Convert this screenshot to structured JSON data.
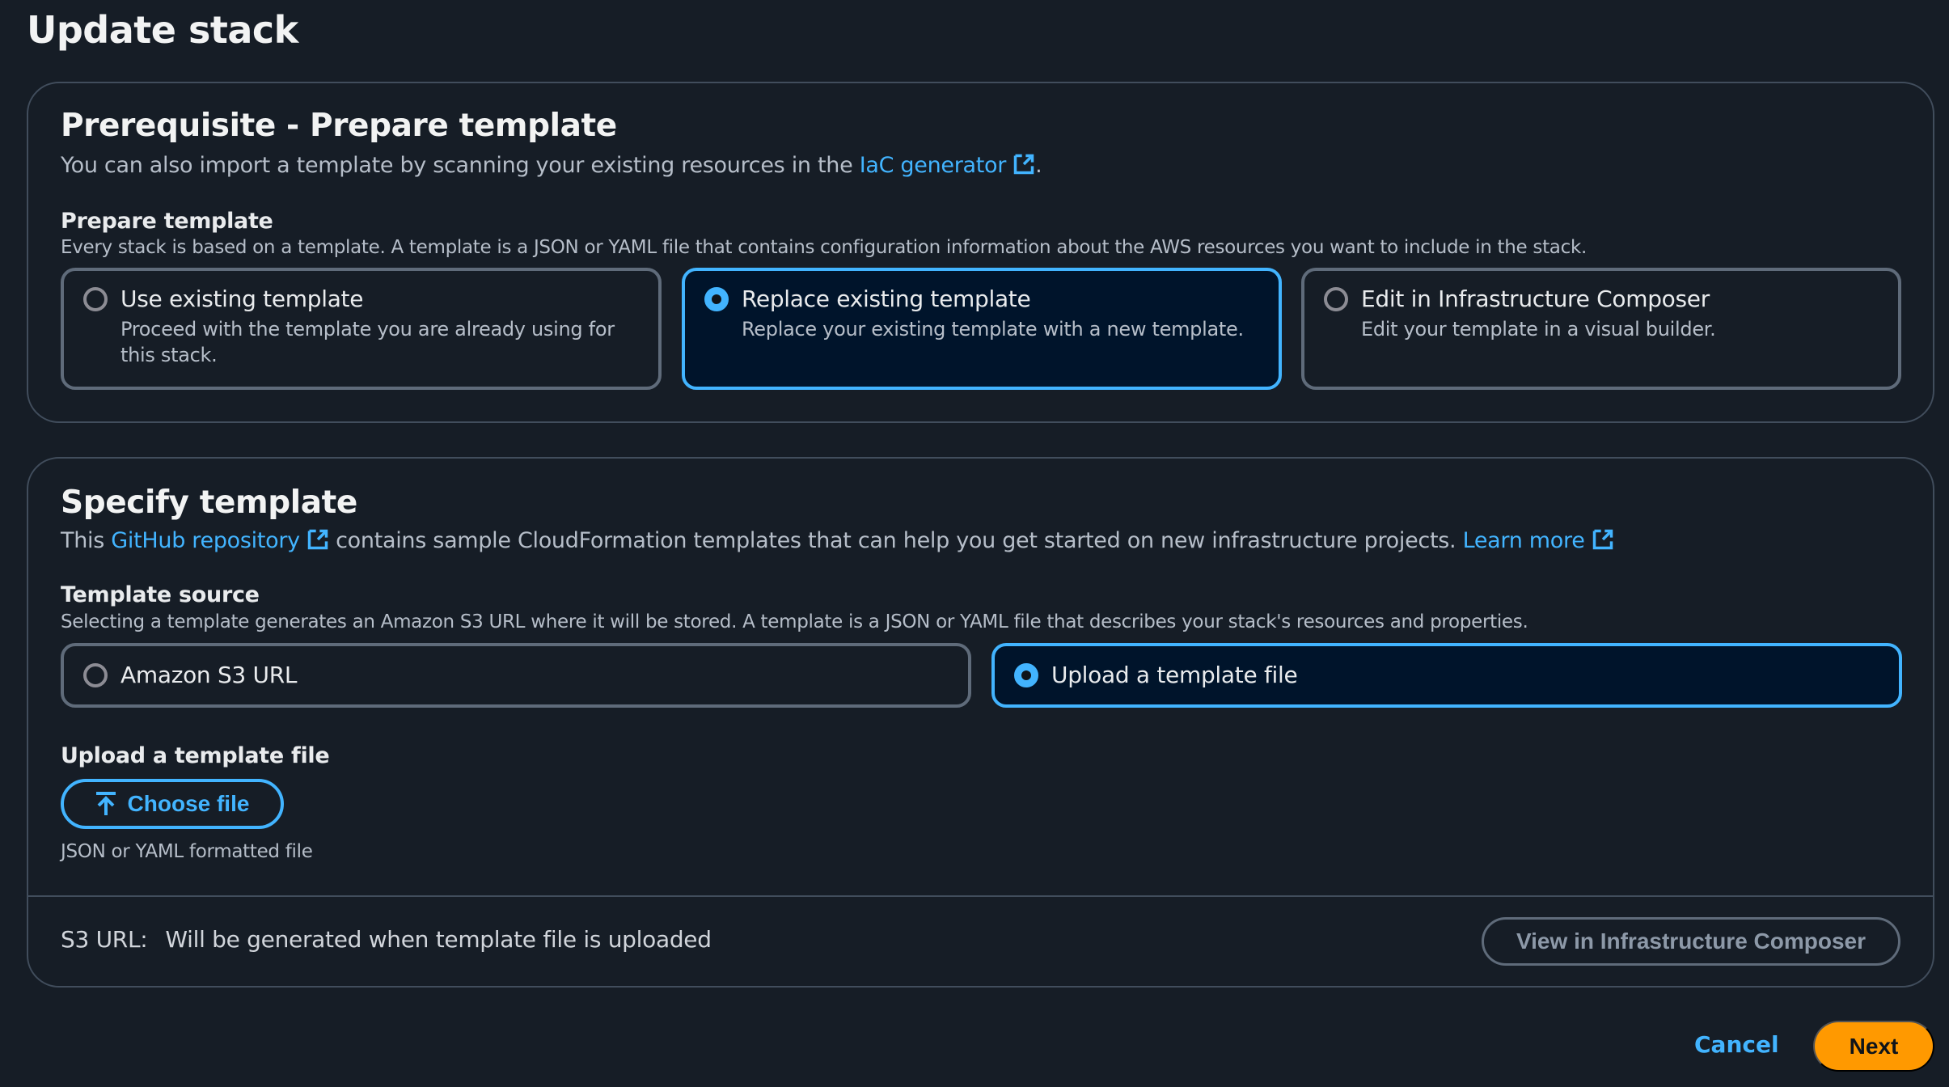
{
  "page": {
    "title": "Update stack"
  },
  "prerequisite": {
    "heading": "Prerequisite - Prepare template",
    "intro_prefix": "You can also import a template by scanning your existing resources in the ",
    "intro_link": "IaC generator",
    "intro_suffix": ".",
    "field_label": "Prepare template",
    "field_description": "Every stack is based on a template. A template is a JSON or YAML file that contains configuration information about the AWS resources you want to include in the stack.",
    "options": [
      {
        "title": "Use existing template",
        "description": "Proceed with the template you are already using for this stack.",
        "selected": false
      },
      {
        "title": "Replace existing template",
        "description": "Replace your existing template with a new template.",
        "selected": true
      },
      {
        "title": "Edit in Infrastructure Composer",
        "description": "Edit your template in a visual builder.",
        "selected": false
      }
    ]
  },
  "specify": {
    "heading": "Specify template",
    "intro_prefix": "This ",
    "intro_link": "GitHub repository",
    "intro_middle": " contains sample CloudFormation templates that can help you get started on new infrastructure projects. ",
    "learn_more": "Learn more",
    "source_label": "Template source",
    "source_description": "Selecting a template generates an Amazon S3 URL where it will be stored. A template is a JSON or YAML file that describes your stack's resources and properties.",
    "source_options": [
      {
        "title": "Amazon S3 URL",
        "selected": false
      },
      {
        "title": "Upload a template file",
        "selected": true
      }
    ],
    "upload_label": "Upload a template file",
    "choose_file": "Choose file",
    "upload_hint": "JSON or YAML formatted file",
    "s3_url_key": "S3 URL:",
    "s3_url_value": "Will be generated when template file is uploaded",
    "view_composer": "View in Infrastructure Composer"
  },
  "footer": {
    "cancel": "Cancel",
    "next": "Next"
  },
  "colors": {
    "background": "#161d26",
    "link": "#42b4ff",
    "primary_button": "#ff9900",
    "selected_tile_bg": "#00142b",
    "border": "#414d5c"
  },
  "icons": {
    "external_link": "external-link-icon",
    "upload": "upload-icon"
  }
}
